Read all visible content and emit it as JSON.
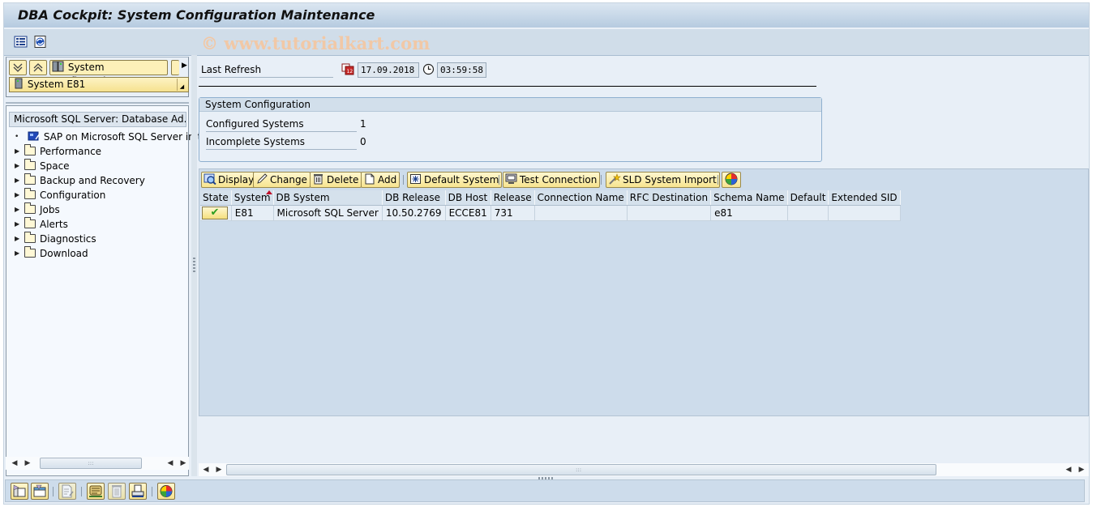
{
  "window": {
    "title": "DBA Cockpit: System Configuration Maintenance",
    "watermark": "© www.tutorialkart.com"
  },
  "app_toolbar": {
    "icons": [
      "list-view-icon",
      "refresh-icon"
    ]
  },
  "nav": {
    "expand_all_tooltip": "expand-all",
    "collapse_all_tooltip": "collapse-all",
    "system_configuration_label": "System Configuration",
    "system_selector_value": "System E81",
    "tree_header": "Microsoft SQL Server: Database Ad...",
    "tree_items": [
      {
        "label": "SAP on Microsoft SQL Server in t",
        "type": "leaf"
      },
      {
        "label": "Performance",
        "type": "folder"
      },
      {
        "label": "Space",
        "type": "folder"
      },
      {
        "label": "Backup and Recovery",
        "type": "folder"
      },
      {
        "label": "Configuration",
        "type": "folder"
      },
      {
        "label": "Jobs",
        "type": "folder"
      },
      {
        "label": "Alerts",
        "type": "folder"
      },
      {
        "label": "Diagnostics",
        "type": "folder"
      },
      {
        "label": "Download",
        "type": "folder"
      }
    ]
  },
  "refresh": {
    "label": "Last Refresh",
    "date": "17.09.2018",
    "time": "03:59:58"
  },
  "system_config": {
    "title": "System Configuration",
    "rows": [
      {
        "label": "Configured Systems",
        "value": "1"
      },
      {
        "label": "Incomplete Systems",
        "value": "0"
      }
    ]
  },
  "grid_toolbar": {
    "display": "Display",
    "change": "Change",
    "delete": "Delete",
    "add": "Add",
    "default_system": "Default System",
    "test_connection": "Test Connection",
    "sld_import": "SLD System Import"
  },
  "grid": {
    "columns": [
      "State",
      "System",
      "DB System",
      "DB Release",
      "DB Host",
      "Release",
      "Connection Name",
      "RFC Destination",
      "Schema Name",
      "Default",
      "Extended SID"
    ],
    "sorted_column": "System",
    "rows": [
      {
        "state": "ok",
        "state_glyph": "✔",
        "system": "E81",
        "db_system": "Microsoft SQL Server",
        "db_release": "10.50.2769",
        "db_host": "ECCE81",
        "release": "731",
        "connection_name": "",
        "rfc_destination": "",
        "schema_name": "e81",
        "default": "",
        "extended_sid": ""
      }
    ]
  },
  "bottom_toolbar": {
    "icons": [
      "open-nav-icon",
      "collapse-nav-icon",
      "edit-document-icon",
      "script-icon",
      "trash-icon",
      "print-icon",
      "color-wheel-icon"
    ]
  }
}
